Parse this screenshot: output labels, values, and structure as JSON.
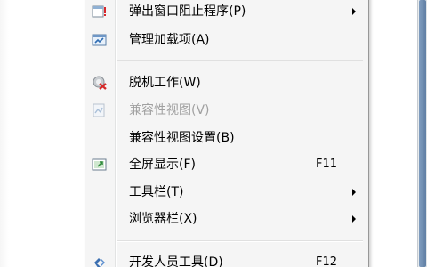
{
  "menu": {
    "items": [
      {
        "label": "弹出窗口阻止程序(P)",
        "shortcut": "",
        "submenu": true,
        "disabled": false,
        "icon": "popup-blocker-icon"
      },
      {
        "label": "管理加载项(A)",
        "shortcut": "",
        "submenu": false,
        "disabled": false,
        "icon": "manage-addons-icon"
      },
      {
        "label": "脱机工作(W)",
        "shortcut": "",
        "submenu": false,
        "disabled": false,
        "icon": "work-offline-icon"
      },
      {
        "label": "兼容性视图(V)",
        "shortcut": "",
        "submenu": false,
        "disabled": true,
        "icon": "compatibility-view-icon"
      },
      {
        "label": "兼容性视图设置(B)",
        "shortcut": "",
        "submenu": false,
        "disabled": false,
        "icon": ""
      },
      {
        "label": "全屏显示(F)",
        "shortcut": "F11",
        "submenu": false,
        "disabled": false,
        "icon": "fullscreen-icon"
      },
      {
        "label": "工具栏(T)",
        "shortcut": "",
        "submenu": true,
        "disabled": false,
        "icon": ""
      },
      {
        "label": "浏览器栏(X)",
        "shortcut": "",
        "submenu": true,
        "disabled": false,
        "icon": ""
      },
      {
        "label": "开发人员工具(D)",
        "shortcut": "F12",
        "submenu": false,
        "disabled": false,
        "icon": "developer-tools-icon"
      }
    ]
  }
}
